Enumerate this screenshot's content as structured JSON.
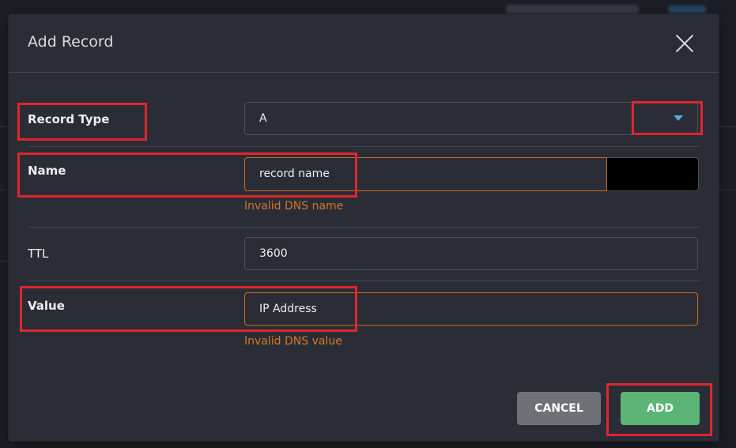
{
  "dialog": {
    "title": "Add Record",
    "close_icon": "close-icon"
  },
  "form": {
    "record_type": {
      "label": "Record Type",
      "value": "A",
      "caret_icon": "caret-down-icon"
    },
    "name": {
      "label": "Name",
      "value": "record name",
      "error": "Invalid DNS name"
    },
    "ttl": {
      "label": "TTL",
      "value": "3600"
    },
    "value": {
      "label": "Value",
      "value": "IP Address",
      "error": "Invalid DNS value"
    }
  },
  "buttons": {
    "cancel": "CANCEL",
    "add": "ADD"
  },
  "colors": {
    "error": "#d8742a",
    "add_button": "#5ab577",
    "cancel_button": "#6f7176",
    "caret": "#5aa8e6",
    "highlight": "#e0252e"
  }
}
